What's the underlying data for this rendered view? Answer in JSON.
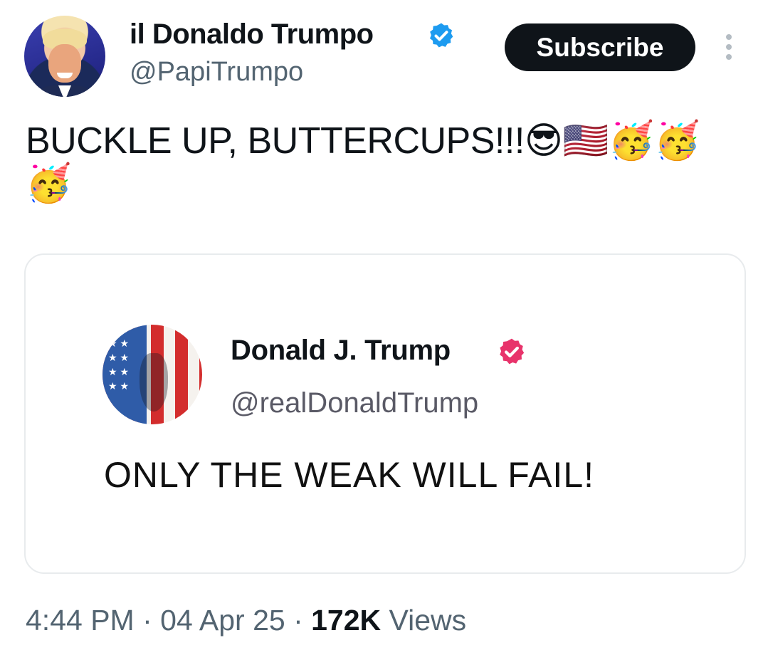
{
  "author": {
    "display_name": "il Donaldo Trumpo",
    "handle": "@PapiTrumpo",
    "verified_badge": "blue-check-icon"
  },
  "actions": {
    "subscribe_label": "Subscribe",
    "more_icon": "more-vertical-icon"
  },
  "tweet": {
    "text": "BUCKLE UP, BUTTERCUPS!!!😎🇺🇸🥳🥳🥳"
  },
  "quoted_post": {
    "display_name": "Donald J. Trump",
    "handle": "@realDonaldTrump",
    "text": "ONLY THE WEAK WILL FAIL!",
    "verified_badge": "pink-check-icon"
  },
  "meta": {
    "time": "4:44 PM",
    "separator": " · ",
    "date": "04 Apr 25",
    "views_count": "172K",
    "views_label": " Views"
  },
  "colors": {
    "verified_blue": "#1d9bf0",
    "verified_pink": "#e8336b",
    "subscribe_bg": "#0f1419",
    "muted_text": "#536471"
  }
}
